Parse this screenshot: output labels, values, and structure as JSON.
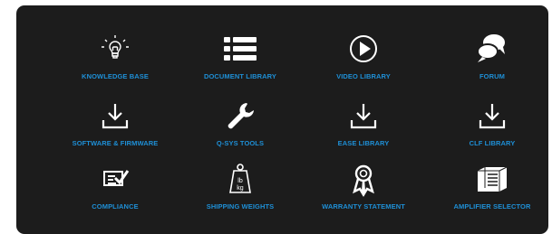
{
  "colors": {
    "background": "#1c1c1c",
    "icon": "#ffffff",
    "label": "#1e8fd6"
  },
  "tiles": [
    {
      "label": "KNOWLEDGE BASE",
      "icon": "lightbulb-icon"
    },
    {
      "label": "DOCUMENT LIBRARY",
      "icon": "list-icon"
    },
    {
      "label": "VIDEO LIBRARY",
      "icon": "play-icon"
    },
    {
      "label": "FORUM",
      "icon": "chat-bubbles-icon"
    },
    {
      "label": "SOFTWARE & FIRMWARE",
      "icon": "download-icon"
    },
    {
      "label": "Q-SYS TOOLS",
      "icon": "wrench-icon"
    },
    {
      "label": "EASE LIBRARY",
      "icon": "download-icon"
    },
    {
      "label": "CLF LIBRARY",
      "icon": "download-icon"
    },
    {
      "label": "COMPLIANCE",
      "icon": "checklist-icon"
    },
    {
      "label": "SHIPPING WEIGHTS",
      "icon": "weight-icon"
    },
    {
      "label": "WARRANTY STATEMENT",
      "icon": "award-ribbon-icon"
    },
    {
      "label": "AMPLIFIER SELECTOR",
      "icon": "amplifier-icon"
    }
  ],
  "weight_icon_text": {
    "top": "lb",
    "bottom": "kg"
  }
}
